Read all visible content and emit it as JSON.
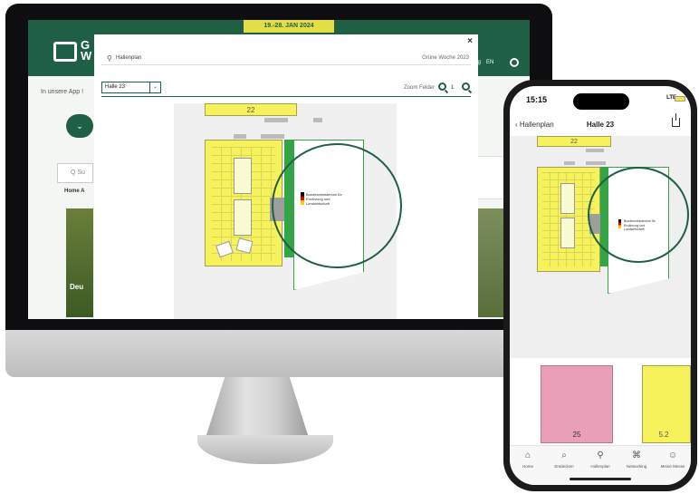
{
  "desktop": {
    "site": {
      "date_banner": "19.-28. JAN 2024",
      "logo_letters": "G W",
      "nav_items": [
        "Blog",
        "EN"
      ],
      "app_text": "In unsere App !",
      "search_placeholder": "Q Su",
      "breadcrumb": "Home A",
      "card_label": "Deu"
    },
    "modal": {
      "close_label": "×",
      "title": "Hallenplan",
      "fair_name": "Grüne Woche 2023",
      "hall_select_value": "Halle 23",
      "zoom_label": "Zoom Felder",
      "zoom_value": "1"
    },
    "plan": {
      "stand_number_top": "22",
      "exhibitor_name": "Bundesministerium für Ernährung und Landwirtschaft"
    }
  },
  "phone": {
    "time": "15:15",
    "network": "LTE",
    "back_label": "Hallenplan",
    "title": "Halle 23",
    "stand_number_top": "22",
    "exhibitor_name": "Bundesministerium für Ernährung und Landwirtschaft",
    "block_left_label": "25",
    "block_right_label": "5.2",
    "tabs": [
      {
        "label": "Home",
        "icon": "home-icon"
      },
      {
        "label": "Entdecken",
        "icon": "search-icon"
      },
      {
        "label": "Hallenplan",
        "icon": "map-pin-icon"
      },
      {
        "label": "Networking",
        "icon": "network-icon"
      },
      {
        "label": "Meine Messe",
        "icon": "user-icon"
      }
    ]
  },
  "colors": {
    "brand_green": "#1f5f46",
    "stand_yellow": "#f5f25c",
    "stand_pink": "#e89fb7",
    "exhibitor_green": "#33a544"
  }
}
